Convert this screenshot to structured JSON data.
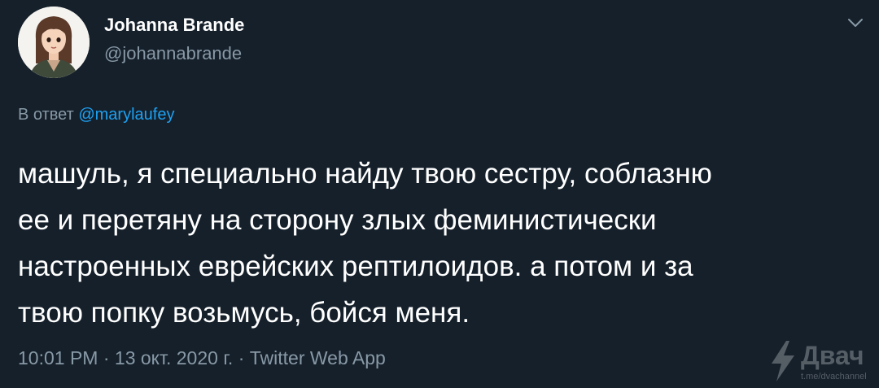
{
  "tweet": {
    "author_name": "Johanna Brande",
    "author_handle": "@johannabrande",
    "reply_prefix": "В ответ",
    "reply_to": "@marylaufey",
    "text_lines": [
      "машуль, я специально найду твою сестру, соблазню",
      "ее и перетяну на сторону злых феминистически",
      "настроенных еврейских рептилоидов. а потом и за",
      "твою попку возьмусь, бойся меня."
    ],
    "time": "10:01 PM",
    "date": "13 окт. 2020 г.",
    "separator": "·",
    "source": "Twitter Web App"
  },
  "watermark": {
    "brand": "Двач",
    "subtext": "t.me/dvachannel"
  },
  "icons": {
    "menu": "chevron-down-icon",
    "watermark_logo": "lightning-bolt-icon"
  },
  "colors": {
    "background": "#15202b",
    "primary_text": "#ffffff",
    "secondary_text": "#8899a6",
    "link": "#1da1f2"
  }
}
